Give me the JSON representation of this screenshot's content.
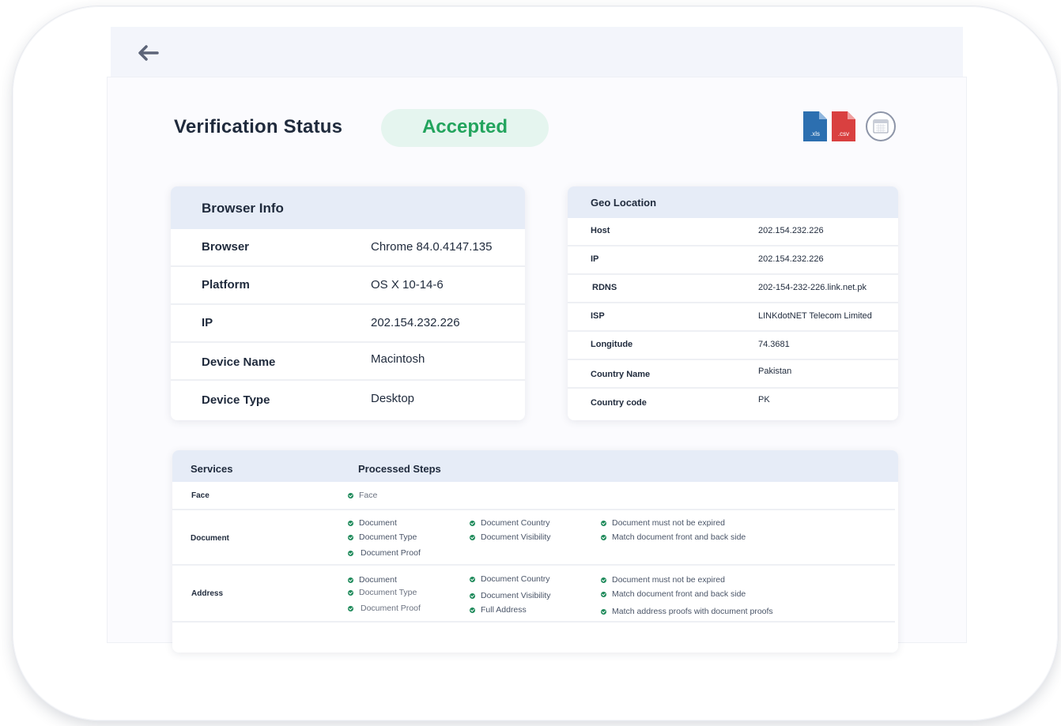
{
  "header": {
    "back_label": "Back"
  },
  "verification": {
    "title": "Verification Status",
    "status": "Accepted"
  },
  "exports": {
    "xls_label": ".xls",
    "csv_label": ".csv"
  },
  "browser_info": {
    "title": "Browser Info",
    "rows": [
      {
        "label": "Browser",
        "value": "Chrome 84.0.4147.135"
      },
      {
        "label": "Platform",
        "value": "OS X 10-14-6"
      },
      {
        "label": "IP",
        "value": "202.154.232.226"
      },
      {
        "label": "Device Name",
        "value": "Macintosh"
      },
      {
        "label": "Device Type",
        "value": "Desktop"
      }
    ]
  },
  "geo_location": {
    "title": "Geo Location",
    "rows": [
      {
        "label": "Host",
        "value": "202.154.232.226"
      },
      {
        "label": "IP",
        "value": "202.154.232.226"
      },
      {
        "label": "RDNS",
        "value": "202-154-232-226.link.net.pk"
      },
      {
        "label": "ISP",
        "value": "LINKdotNET Telecom Limited"
      },
      {
        "label": "Longitude",
        "value": "74.3681"
      },
      {
        "label": "Country Name",
        "value": "Pakistan"
      },
      {
        "label": "Country code",
        "value": "PK"
      }
    ]
  },
  "services": {
    "col_services": "Services",
    "col_steps": "Processed Steps",
    "face": {
      "name": "Face",
      "steps": [
        "Face"
      ]
    },
    "document": {
      "name": "Document",
      "steps": [
        "Document",
        "Document Type",
        "Document Proof",
        "Document Country",
        "Document Visibility",
        "Document must not be expired",
        "Match document front and back side"
      ]
    },
    "address": {
      "name": "Address",
      "steps": [
        "Document",
        "Document Type",
        "Document Proof",
        "Document Country",
        "Document Visibility",
        "Full Address",
        "Document must not be expired",
        "Match document front and back side",
        "Match address proofs with document proofs"
      ]
    }
  },
  "colors": {
    "accent_green": "#22a45d",
    "pill_bg": "#e5f5ef",
    "xls_blue": "#2c6fb0",
    "csv_red": "#d94040",
    "header_bg": "#e6ecf7"
  }
}
